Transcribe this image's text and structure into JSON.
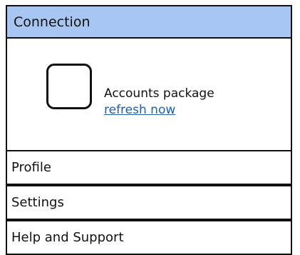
{
  "connection": {
    "header_label": "Connection",
    "account_name": "Accounts package",
    "refresh_link": "refresh now"
  },
  "menu": {
    "profile": "Profile",
    "settings": "Settings",
    "help": "Help and Support"
  },
  "colors": {
    "header_bg": "#a7c6f2",
    "link": "#1f5fa8",
    "border": "#111111"
  }
}
